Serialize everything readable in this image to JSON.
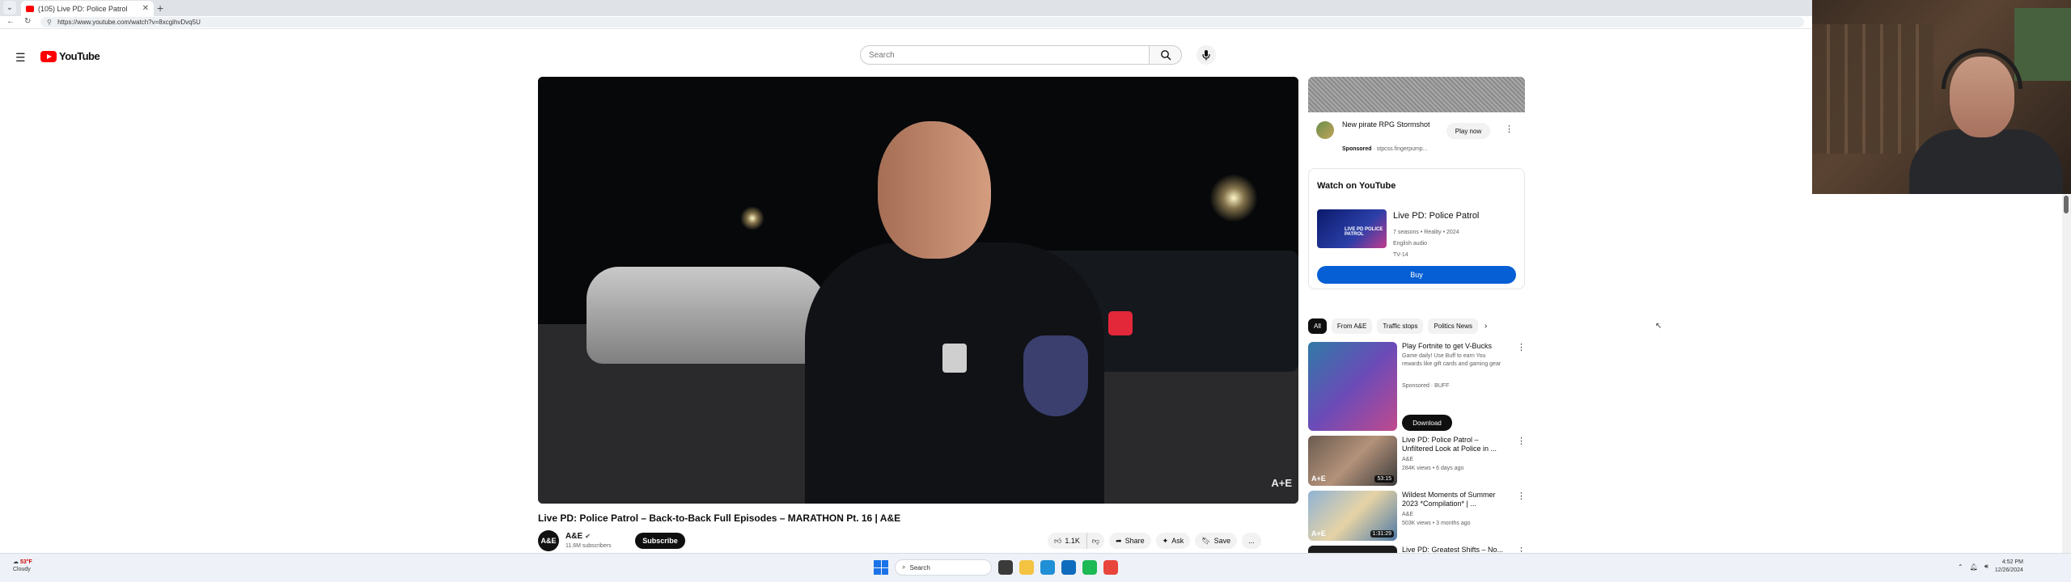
{
  "browser": {
    "tab_title": "(105) Live PD: Police Patrol",
    "url": "https://www.youtube.com/watch?v=8xcgihvDvq5U"
  },
  "masthead": {
    "logo_text": "YouTube",
    "search_placeholder": "Search"
  },
  "video": {
    "title": "Live PD: Police Patrol – Back-to-Back Full Episodes – MARATHON Pt. 16 | A&E",
    "watermark": "A+E",
    "channel": {
      "avatar_text": "A&E",
      "name": "A&E",
      "subscribers": "11.6M subscribers"
    },
    "subscribe_label": "Subscribe",
    "actions": {
      "likes": "1.1K",
      "share": "Share",
      "ask": "Ask",
      "save": "Save",
      "more": "..."
    }
  },
  "ad": {
    "title": "New pirate RPG Stormshot",
    "sponsored_label": "Sponsored",
    "sponsored_domain": "stpcss.fingerpump...",
    "play_label": "Play now"
  },
  "watch_card": {
    "heading": "Watch on YouTube",
    "show_title": "Live PD: Police Patrol",
    "thumb_text": "LIVE PD POLICE PATROL",
    "meta_line1": "7 seasons • Reality • 2024",
    "meta_line2": "English audio",
    "meta_line3": "TV-14",
    "buy_label": "Buy"
  },
  "chips": [
    "All",
    "From A&E",
    "Traffic stops",
    "Politics News"
  ],
  "recommendations": [
    {
      "title": "Play Fortnite to get V-Bucks",
      "description": "Game daily! Use Buff to earn You rewards like gift cards and gaming gear",
      "channel": "Sponsored · BUFF",
      "stats": "",
      "duration": "",
      "action_label": "Download"
    },
    {
      "title": "Live PD: Police Patrol – Unfiltered Look at Police in ...",
      "description": "",
      "channel": "A&E",
      "stats": "284K views • 6 days ago",
      "duration": "53:15"
    },
    {
      "title": "Wildest Moments of Summer 2023 *Compilation* | ...",
      "description": "",
      "channel": "A&E",
      "stats": "503K views • 3 months ago",
      "duration": "1:31:29"
    },
    {
      "title": "Live PD: Greatest Shifts – No...",
      "description": "",
      "channel": "",
      "stats": "",
      "duration": ""
    }
  ],
  "taskbar": {
    "weather_temp": "53°F",
    "weather_text": "Cloudy",
    "search_label": "Search",
    "time": "4:52 PM",
    "date": "12/26/2024"
  }
}
